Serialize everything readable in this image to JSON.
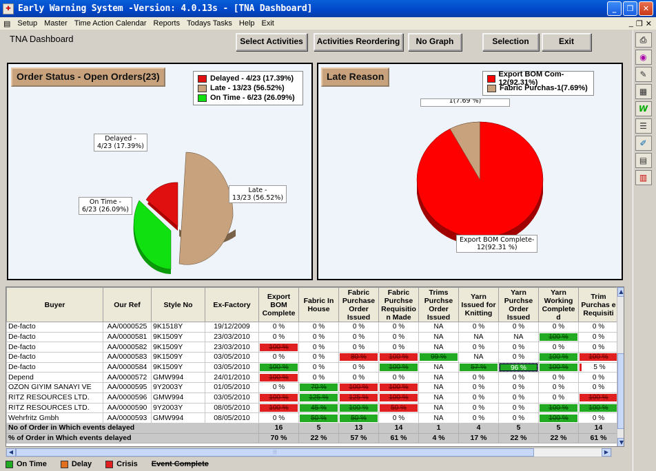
{
  "window": {
    "title": "Early Warning System -Version: 4.0.13s - [TNA Dashboard]"
  },
  "menu": {
    "items": [
      "Setup",
      "Master",
      "Time Action Calendar",
      "Reports",
      "Todays Tasks",
      "Help",
      "Exit"
    ]
  },
  "page": {
    "title": "TNA Dashboard"
  },
  "buttons": {
    "select_activities": "Select Activities",
    "activities_reordering": "Activities Reordering",
    "no_graph": "No Graph",
    "selection": "Selection",
    "exit": "Exit"
  },
  "order_status": {
    "title": "Order Status - Open Orders(23)",
    "legend": [
      "Delayed - 4/23 (17.39%)",
      "Late - 13/23 (56.52%)",
      "On Time - 6/23 (26.09%)"
    ],
    "labels": {
      "delayed_1": "Delayed -",
      "delayed_2": "4/23 (17.39%)",
      "late_1": "Late -",
      "late_2": "13/23 (56.52%)",
      "ontime_1": "On Time -",
      "ontime_2": "6/23 (26.09%)"
    }
  },
  "late_reason": {
    "title": "Late Reason",
    "legend": [
      "Export BOM Com-12(92.31%)",
      "Fabric Purchas-1(7.69%)"
    ],
    "labels": {
      "top": "1(7.69 %)",
      "export_1": "Export BOM Complete-",
      "export_2": "12(92.31 %)"
    }
  },
  "chart_data": [
    {
      "type": "pie",
      "title": "Order Status - Open Orders(23)",
      "categories": [
        "Delayed",
        "Late",
        "On Time"
      ],
      "values": [
        4,
        13,
        6
      ],
      "colors": [
        "#e01010",
        "#c8a27c",
        "#10e010"
      ]
    },
    {
      "type": "pie",
      "title": "Late Reason",
      "categories": [
        "Export BOM Complete",
        "Fabric Purchase"
      ],
      "values": [
        12,
        1
      ],
      "colors": [
        "#ff0000",
        "#c8a27c"
      ]
    }
  ],
  "grid": {
    "headers": [
      "Buyer",
      "Our Ref",
      "Style No",
      "Ex-Factory",
      "Export BOM Complete",
      "Fabric In House",
      "Fabric Purchase Order Issued",
      "Fabric Purchse Requisitio n Made",
      "Trims Purchse Order Issued",
      "Yarn Issued for Knitting",
      "Yarn Purchse Order Issued",
      "Yarn Working Complete d",
      "Trim Purchas e Requisiti"
    ],
    "rows": [
      {
        "buyer": "De-facto",
        "ref": "AA/0000525",
        "style": "9K1518Y",
        "exf": "19/12/2009",
        "v": [
          [
            "0 %",
            ""
          ],
          [
            "0 %",
            ""
          ],
          [
            "0 %",
            ""
          ],
          [
            "0 %",
            ""
          ],
          [
            "NA",
            ""
          ],
          [
            "0 %",
            ""
          ],
          [
            "0 %",
            ""
          ],
          [
            "0 %",
            ""
          ],
          [
            "0 %",
            ""
          ]
        ]
      },
      {
        "buyer": "De-facto",
        "ref": "AA/0000581",
        "style": "9K1509Y",
        "exf": "23/03/2010",
        "v": [
          [
            "0 %",
            ""
          ],
          [
            "0 %",
            ""
          ],
          [
            "0 %",
            ""
          ],
          [
            "0 %",
            ""
          ],
          [
            "NA",
            ""
          ],
          [
            "NA",
            ""
          ],
          [
            "NA",
            ""
          ],
          [
            "100 %",
            "g"
          ],
          [
            "0 %",
            ""
          ]
        ]
      },
      {
        "buyer": "De-facto",
        "ref": "AA/0000582",
        "style": "9K1509Y",
        "exf": "23/03/2010",
        "v": [
          [
            "100 %",
            "r"
          ],
          [
            "0 %",
            ""
          ],
          [
            "0 %",
            ""
          ],
          [
            "0 %",
            ""
          ],
          [
            "NA",
            ""
          ],
          [
            "0 %",
            ""
          ],
          [
            "0 %",
            ""
          ],
          [
            "0 %",
            ""
          ],
          [
            "0 %",
            ""
          ]
        ]
      },
      {
        "buyer": "De-facto",
        "ref": "AA/0000583",
        "style": "9K1509Y",
        "exf": "03/05/2010",
        "v": [
          [
            "0 %",
            ""
          ],
          [
            "0 %",
            ""
          ],
          [
            "80 %",
            "r"
          ],
          [
            "100 %",
            "r"
          ],
          [
            "99 %",
            "g"
          ],
          [
            "NA",
            ""
          ],
          [
            "0 %",
            ""
          ],
          [
            "100 %",
            "g"
          ],
          [
            "100 %",
            "r"
          ]
        ]
      },
      {
        "buyer": "De-facto",
        "ref": "AA/0000584",
        "style": "9K1509Y",
        "exf": "03/05/2010",
        "v": [
          [
            "100 %",
            "g"
          ],
          [
            "0 %",
            ""
          ],
          [
            "0 %",
            ""
          ],
          [
            "100 %",
            "g"
          ],
          [
            "NA",
            ""
          ],
          [
            "57 %",
            "g"
          ],
          [
            "96 %",
            "gsel"
          ],
          [
            "100 %",
            "g"
          ],
          [
            "5 %",
            "nar"
          ]
        ]
      },
      {
        "buyer": "Depend",
        "ref": "AA/0000572",
        "style": "GMW994",
        "exf": "24/01/2010",
        "v": [
          [
            "100 %",
            "r"
          ],
          [
            "0 %",
            ""
          ],
          [
            "0 %",
            ""
          ],
          [
            "0 %",
            ""
          ],
          [
            "NA",
            ""
          ],
          [
            "0 %",
            ""
          ],
          [
            "0 %",
            ""
          ],
          [
            "0 %",
            ""
          ],
          [
            "0 %",
            ""
          ]
        ]
      },
      {
        "buyer": "OZON GIYIM SANAYI VE",
        "ref": "AA/0000595",
        "style": "9Y2003Y",
        "exf": "01/05/2010",
        "v": [
          [
            "0 %",
            ""
          ],
          [
            "70 %",
            "g"
          ],
          [
            "100 %",
            "r"
          ],
          [
            "100 %",
            "r"
          ],
          [
            "NA",
            ""
          ],
          [
            "0 %",
            ""
          ],
          [
            "0 %",
            ""
          ],
          [
            "0 %",
            ""
          ],
          [
            "0 %",
            ""
          ]
        ]
      },
      {
        "buyer": "RITZ RESOURCES LTD.",
        "ref": "AA/0000596",
        "style": "GMW994",
        "exf": "03/05/2010",
        "v": [
          [
            "100 %",
            "r"
          ],
          [
            "125 %",
            "g"
          ],
          [
            "125 %",
            "r"
          ],
          [
            "100 %",
            "r"
          ],
          [
            "NA",
            ""
          ],
          [
            "0 %",
            ""
          ],
          [
            "0 %",
            ""
          ],
          [
            "0 %",
            ""
          ],
          [
            "100 %",
            "r"
          ]
        ]
      },
      {
        "buyer": "RITZ RESOURCES LTD.",
        "ref": "AA/0000590",
        "style": "9Y2003Y",
        "exf": "08/05/2010",
        "v": [
          [
            "100 %",
            "r"
          ],
          [
            "45 %",
            "g"
          ],
          [
            "100 %",
            "g"
          ],
          [
            "50 %",
            "r"
          ],
          [
            "NA",
            ""
          ],
          [
            "0 %",
            ""
          ],
          [
            "0 %",
            ""
          ],
          [
            "100 %",
            "g"
          ],
          [
            "100 %",
            "g"
          ]
        ]
      },
      {
        "buyer": "Wehrfritz Gmbh",
        "ref": "AA/0000593",
        "style": "GMW994",
        "exf": "08/05/2010",
        "v": [
          [
            "0 %",
            ""
          ],
          [
            "50 %",
            "g"
          ],
          [
            "50 %",
            "g"
          ],
          [
            "0 %",
            ""
          ],
          [
            "NA",
            ""
          ],
          [
            "0 %",
            ""
          ],
          [
            "0 %",
            ""
          ],
          [
            "100 %",
            "g"
          ],
          [
            "0 %",
            ""
          ]
        ]
      }
    ],
    "summary": [
      {
        "label": "No of Order in Which events delayed",
        "v": [
          "16",
          "5",
          "13",
          "14",
          "1",
          "4",
          "5",
          "5",
          "14"
        ]
      },
      {
        "label": "% of Order in Which events delayed",
        "v": [
          "70 %",
          "22 %",
          "57 %",
          "61 %",
          "4 %",
          "17 %",
          "22 %",
          "22 %",
          "61 %"
        ]
      }
    ]
  },
  "bottom_legend": {
    "on_time": "On Time",
    "delay": "Delay",
    "crisis": "Crisis",
    "complete": "Event Complete",
    "colors": {
      "on_time": "#22aa22",
      "delay": "#e07020",
      "crisis": "#e02020"
    }
  }
}
